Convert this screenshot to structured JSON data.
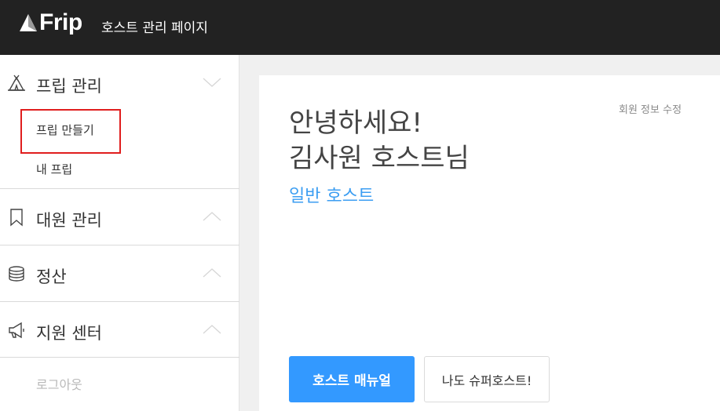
{
  "header": {
    "logo_text": "Frip",
    "title": "호스트 관리 페이지"
  },
  "sidebar": {
    "sections": [
      {
        "label": "프립 관리",
        "icon": "tent-icon",
        "expanded": true,
        "items": [
          {
            "label": "프립 만들기",
            "highlighted": true
          },
          {
            "label": "내 프립"
          }
        ]
      },
      {
        "label": "대원 관리",
        "icon": "bookmark-icon",
        "expanded": false
      },
      {
        "label": "정산",
        "icon": "coins-icon",
        "expanded": false
      },
      {
        "label": "지원 센터",
        "icon": "megaphone-icon",
        "expanded": false
      }
    ],
    "logout_label": "로그아웃"
  },
  "main": {
    "greeting_line1": "안녕하세요!",
    "greeting_line2": "김사원 호스트님",
    "host_type": "일반 호스트",
    "edit_profile_label": "회원 정보 수정",
    "manual_button": "호스트 매뉴얼",
    "super_host_button": "나도 슈퍼호스트!"
  },
  "colors": {
    "topbar": "#222222",
    "accent": "#3399ff",
    "host_type_text": "#3c9ef2",
    "highlight_border": "#e01e1e"
  }
}
